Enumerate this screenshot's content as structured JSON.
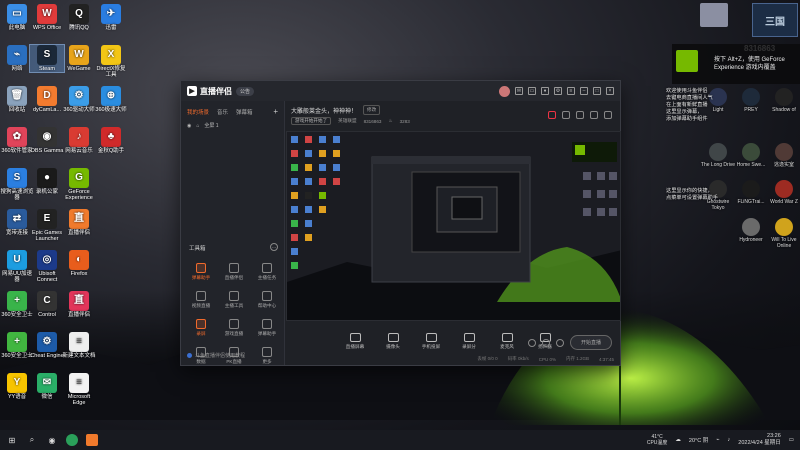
{
  "desktop": {
    "icons_col1": [
      {
        "label": "此电脑",
        "color": "#3a8ee6",
        "glyph": "▭"
      },
      {
        "label": "网络",
        "color": "#2a6fc0",
        "glyph": "⌁"
      },
      {
        "label": "回收站",
        "color": "#8aa2bc",
        "glyph": "🗑"
      },
      {
        "label": "360软件管家",
        "color": "#e0445a",
        "glyph": "✿"
      },
      {
        "label": "搜狗高速浏览器",
        "color": "#2b7fe0",
        "glyph": "S"
      },
      {
        "label": "宽带连接",
        "color": "#2a5b9c",
        "glyph": "⇄"
      },
      {
        "label": "网易UU加速器",
        "color": "#1c9de0",
        "glyph": "U"
      },
      {
        "label": "360安全卫士",
        "color": "#39b44a",
        "glyph": "+"
      },
      {
        "label": "360安全卫士",
        "color": "#41b640",
        "glyph": "+"
      },
      {
        "label": "YY语音",
        "color": "#f7c400",
        "glyph": "Y"
      }
    ],
    "icons_col2": [
      {
        "label": "WPS Office",
        "color": "#e03b3b",
        "glyph": "W"
      },
      {
        "label": "Steam",
        "color": "#1b2838",
        "glyph": "S"
      },
      {
        "label": "dyCamLa...",
        "color": "#f27b2f",
        "glyph": "D"
      },
      {
        "label": "OBS Gamma",
        "color": "#333",
        "glyph": "◉"
      },
      {
        "label": "录机公家",
        "color": "#1a1a1a",
        "glyph": "●"
      },
      {
        "label": "Epic Games Launcher",
        "color": "#222",
        "glyph": "E"
      },
      {
        "label": "Ubisoft Connect",
        "color": "#1c3a8a",
        "glyph": "◎"
      },
      {
        "label": "Control",
        "color": "#333",
        "glyph": "C"
      },
      {
        "label": "Cheat Engine",
        "color": "#1d5ba8",
        "glyph": "⚙"
      },
      {
        "label": "微信",
        "color": "#2aae67",
        "glyph": "✉"
      }
    ],
    "icons_col3": [
      {
        "label": "腾讯QQ",
        "color": "#222",
        "glyph": "Q"
      },
      {
        "label": "WeGame",
        "color": "#e8a41a",
        "glyph": "W"
      },
      {
        "label": "360驱动大师",
        "color": "#3b9de8",
        "glyph": "⚙"
      },
      {
        "label": "网易云音乐",
        "color": "#d93b32",
        "glyph": "♪"
      },
      {
        "label": "GeForce Experience",
        "color": "#76b900",
        "glyph": "G"
      },
      {
        "label": "直播伴侣",
        "color": "#f07a2c",
        "glyph": "直"
      },
      {
        "label": "Firefox",
        "color": "#e85d1c",
        "glyph": "◐"
      },
      {
        "label": "直播伴侣",
        "color": "#e2355a",
        "glyph": "直"
      },
      {
        "label": "新建文本文档",
        "color": "#eeeeee",
        "glyph": "≡"
      },
      {
        "label": "Microsoft Edge",
        "color": "#f2f2f2",
        "glyph": "≡"
      }
    ],
    "icons_col4": [
      {
        "label": "迅雷",
        "color": "#2a7de1",
        "glyph": "✈"
      },
      {
        "label": "DirectX修复工具",
        "color": "#f3c615",
        "glyph": "X"
      },
      {
        "label": "360极速大师",
        "color": "#2a8de0",
        "glyph": "⊕"
      },
      {
        "label": "金秋Q助手",
        "color": "#d02a2a",
        "glyph": "♣"
      }
    ],
    "right_icons": [
      {
        "label": "The Long Drive",
        "color": "#404648"
      },
      {
        "label": "Home Swe...",
        "color": "#3b4b3a"
      },
      {
        "label": "逃逸实室",
        "color": "#503a36"
      },
      {
        "label": "Ghostwire Tokyo",
        "color": "#2a2a2a"
      },
      {
        "label": "FLiNGTrai...",
        "color": "#1b1b1b"
      },
      {
        "label": "World War Z",
        "color": "#9d2b22"
      },
      {
        "label": "Hydroneer",
        "color": "#6a6a6a"
      },
      {
        "label": "Will To Live Online",
        "color": "#d0a31c"
      }
    ],
    "right_top_icons": [
      {
        "label": "PREY",
        "color": "#1e2a3a"
      },
      {
        "label": "Shadow of",
        "color": "#222"
      },
      {
        "label": "Light",
        "color": "#2a3350"
      }
    ]
  },
  "overlay": {
    "room_number": "8316863",
    "notification_text_line1": "按下 Alt+Z，使用 GeForce",
    "notification_text_line2": "Experience 游戏内覆盖",
    "side_text_1": "欢迎使用斗鱼伴侣\n去键电商直播间人气\n在上面有新鲜直播\n这里显示弹幕，\n添加弹幕助手组件",
    "side_text_2": "这里显示你的快捷，\n点菜单可设置弹幕助手",
    "streamer_caption": "Accel\nCreat..."
  },
  "app": {
    "name": "直播伴侣",
    "badge": "公告",
    "tabs": [
      "我的场景",
      "音乐",
      "弹幕箱"
    ],
    "scene_label": "全屏 1",
    "room_title": "大雕般莱金头，神神神！",
    "edit_label": "修改",
    "room_tag": "游戏开始开始了",
    "room_category": "英雄联盟",
    "room_id": "8316863",
    "fans": "3283",
    "tools_label": "工具箱",
    "tools": [
      {
        "label": "弹幕助手",
        "active": true
      },
      {
        "label": "直播伴侣",
        "active": false
      },
      {
        "label": "主播任务",
        "active": false
      },
      {
        "label": "视频直播",
        "active": false
      },
      {
        "label": "主播工具",
        "active": false
      },
      {
        "label": "帮助中心",
        "active": false
      },
      {
        "label": "录屏",
        "active": true
      },
      {
        "label": "游戏直播",
        "active": false
      },
      {
        "label": "弹幕助手",
        "active": false
      },
      {
        "label": "数据",
        "active": false
      },
      {
        "label": "PK直播",
        "active": false
      },
      {
        "label": "更多",
        "active": false
      }
    ],
    "footer_text": "斗鱼直播伴侣使用教程",
    "bottom_tools": [
      "直播屏幕",
      "摄像头",
      "手机投屏",
      "录屏分",
      "麦克风",
      "扬声器"
    ],
    "go_live": "开始直播",
    "status": [
      "丢帧 0/0 0",
      "码率 0kb/s",
      "CPU 0%",
      "内存 1.2GB",
      "4:37:45"
    ]
  },
  "taskbar": {
    "weather": "20°C 阴",
    "cpu_temp": "41°C",
    "cpu_label": "CPU温度",
    "time": "23:26",
    "date": "2022/4/24 星期日"
  }
}
